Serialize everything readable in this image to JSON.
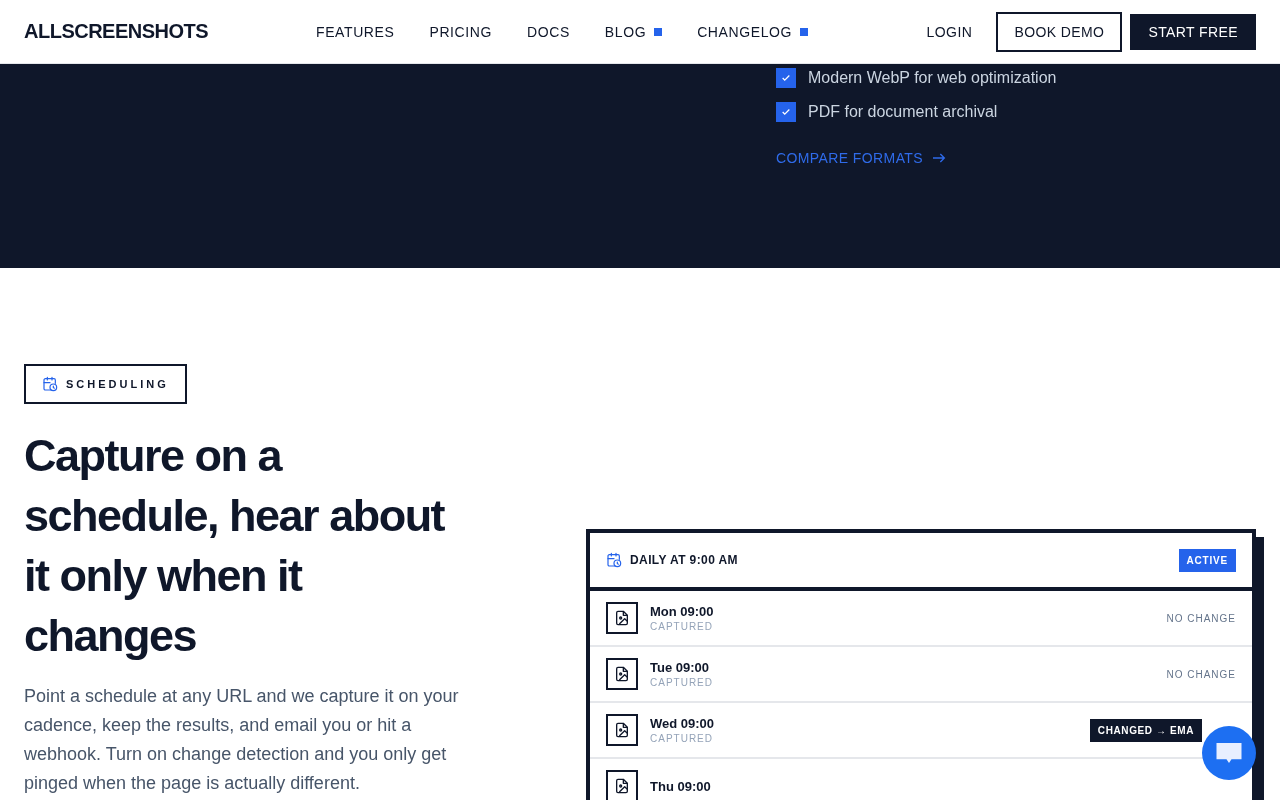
{
  "header": {
    "logo": "ALLSCREENSHOTS",
    "nav": [
      {
        "label": "FEATURES",
        "dot": false
      },
      {
        "label": "PRICING",
        "dot": false
      },
      {
        "label": "DOCS",
        "dot": false
      },
      {
        "label": "BLOG",
        "dot": true
      },
      {
        "label": "CHANGELOG",
        "dot": true
      }
    ],
    "login": "LOGIN",
    "book_demo": "BOOK DEMO",
    "start_free": "START FREE"
  },
  "formats": {
    "items": [
      {
        "label": "Modern WebP for web optimization",
        "checked": true
      },
      {
        "label": "PDF for document archival",
        "checked": true
      }
    ],
    "link": "COMPARE FORMATS"
  },
  "scheduling": {
    "badge": "SCHEDULING",
    "heading": "Capture on a schedule, hear about it only when it changes",
    "body": "Point a schedule at any URL and we capture it on your cadence, keep the results, and email you or hit a webhook. Turn on change detection and you only get pinged when the page is actually different.",
    "card": {
      "title": "DAILY AT 9:00 AM",
      "status": "ACTIVE",
      "rows": [
        {
          "time": "Mon 09:00",
          "state": "CAPTURED",
          "result": "NO CHANGE",
          "kind": "plain"
        },
        {
          "time": "Tue 09:00",
          "state": "CAPTURED",
          "result": "NO CHANGE",
          "kind": "plain"
        },
        {
          "time": "Wed 09:00",
          "state": "CAPTURED",
          "result": "CHANGED → EMA",
          "kind": "changed"
        },
        {
          "time": "Thu 09:00",
          "kind": "partial"
        }
      ]
    }
  }
}
